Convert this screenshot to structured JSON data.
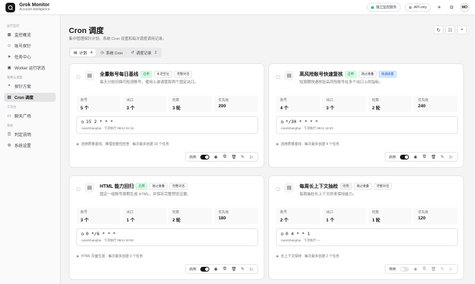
{
  "app": {
    "title": "Grok Monitor",
    "subtitle": "Account intelligence"
  },
  "topbar": {
    "service": "独立监控服务",
    "api": "API-only",
    "avatar": "MO",
    "service_dot": "#22c55e",
    "api_dot": "#a1a1aa"
  },
  "sidebar": {
    "sections": [
      {
        "label": "运行监控",
        "items": [
          {
            "label": "监控概览",
            "icon": "grid-icon"
          },
          {
            "label": "账号探针",
            "icon": "user-icon"
          },
          {
            "label": "任务中心",
            "icon": "send-icon"
          },
          {
            "label": "Worker 运行状态",
            "icon": "cpu-icon"
          }
        ]
      },
      {
        "label": "策略与调度",
        "items": [
          {
            "label": "探针方案",
            "icon": "probe-icon"
          },
          {
            "label": "Cron 调度",
            "icon": "calendar-icon",
            "active": true
          }
        ]
      },
      {
        "label": "工作台",
        "items": [
          {
            "label": "聊天广场",
            "icon": "chat-icon"
          }
        ]
      },
      {
        "label": "系统",
        "items": [
          {
            "label": "判定说明",
            "icon": "doc-icon"
          },
          {
            "label": "系统设置",
            "icon": "settings-icon"
          }
        ]
      }
    ]
  },
  "page": {
    "title": "Cron 调度",
    "subtitle": "集中管理探针计划、系统 Cron 设置和每次调度调用记录。"
  },
  "tabs": [
    {
      "label": "计划",
      "count": "4",
      "icon": "calendar-icon",
      "active": true
    },
    {
      "label": "系统 Cron",
      "count": "",
      "icon": "clock-icon"
    },
    {
      "label": "调度记录",
      "count": "2",
      "icon": "history-icon"
    }
  ],
  "stat_labels": {
    "accounts": "账号",
    "exits": "出口",
    "rounds": "轮数",
    "priority": "优先级"
  },
  "plans": [
    {
      "title": "全量账号每日基线",
      "tags": [
        {
          "text": "启用",
          "style": "green"
        },
        {
          "text": "补足空位",
          "style": "plain"
        },
        {
          "text": "完整对话",
          "style": "plain"
        }
      ],
      "desc": "每天分批扫描可检测账号，使用上游调度和两个固定出口。",
      "accounts": "5 个",
      "exits": "3 个",
      "rounds": "3 轮",
      "priority": "200",
      "cron": "15 2 * * *",
      "meta": "Asia/Shanghai · 下次执行 08/12 02:15",
      "note": "选用质量基线。推理完整性检查 · 每次最多创建 10 个任务",
      "toggle_label": "启用",
      "enabled": true
    },
    {
      "title": "高风险账号快速复核",
      "tags": [
        {
          "text": "启用",
          "style": "green"
        },
        {
          "text": "跳过重叠",
          "style": "plain"
        },
        {
          "text": "快速质量",
          "style": "blue"
        }
      ],
      "desc": "短周期快速核验高风险账号在多个出口上的指标。",
      "accounts": "4 个",
      "exits": "3 个",
      "rounds": "2 轮",
      "priority": "240",
      "cron": "*/30 * * * *",
      "meta": "Asia/Shanghai · 下次执行 08/11 18:30",
      "note": "选用质量基线 · 每次最多创建 4 个任务",
      "toggle_label": "启用",
      "enabled": true
    },
    {
      "title": "HTML 能力回归",
      "tags": [
        {
          "text": "启用",
          "style": "green"
        },
        {
          "text": "跳过重叠",
          "style": "plain"
        },
        {
          "text": "完整对话",
          "style": "plain"
        }
      ],
      "desc": "固定一组账号周期生成 HTML，并保存完整预览证据。",
      "accounts": "3 个",
      "exits": "1 个",
      "rounds": "2 轮",
      "priority": "180",
      "cron": "0 */6 * * *",
      "meta": "Asia/Shanghai · 下次执行 08/12 00:00",
      "note": "HTML 页面生成 · 每次最多创建 3 个任务",
      "toggle_label": "启用",
      "enabled": true
    },
    {
      "title": "每周长上下文抽检",
      "tags": [
        {
          "text": "停用",
          "style": "gray"
        },
        {
          "text": "跳过重叠",
          "style": "plain"
        },
        {
          "text": "完整对话",
          "style": "plain"
        }
      ],
      "desc": "每周抽检长上下文的来保持能力。",
      "accounts": "2 个",
      "exits": "1 个",
      "rounds": "1 轮",
      "priority": "120",
      "cron": "0 4 * * 1",
      "meta": "Asia/Shanghai · 下次执行 —",
      "note": "长上下文保持 · 每次最多创建 2 个任务",
      "toggle_label": "停用",
      "enabled": false
    }
  ]
}
